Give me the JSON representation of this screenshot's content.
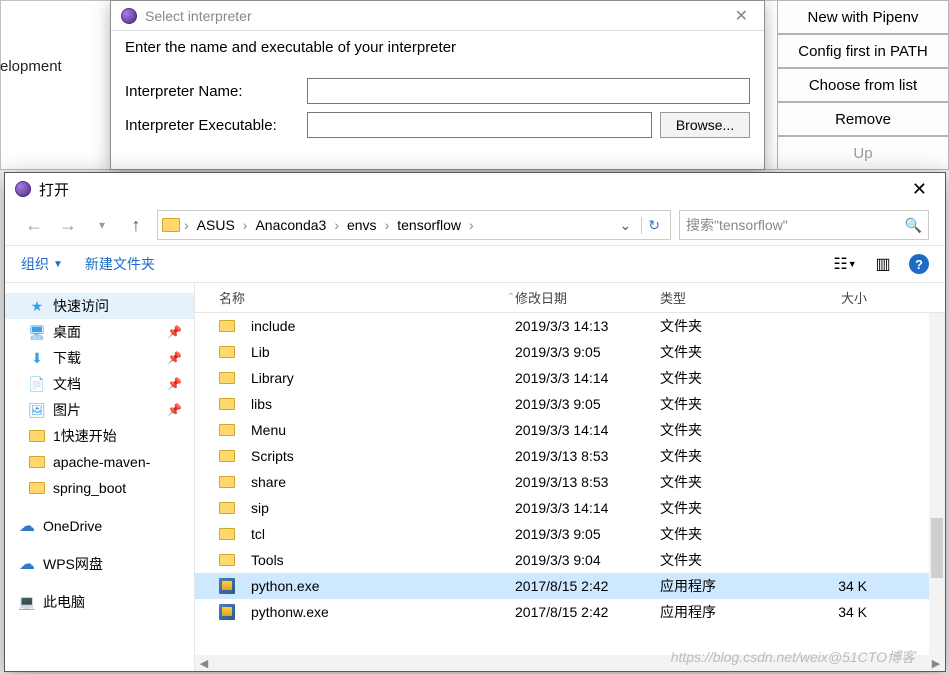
{
  "background": {
    "leftLabel": "elopment"
  },
  "rightButtons": {
    "b1": "New with Pipenv",
    "b2": "Config first in PATH",
    "b3": "Choose from list",
    "b4": "Remove",
    "b5": "Up"
  },
  "interpDialog": {
    "title": "Select interpreter",
    "prompt": "Enter the name and executable of your interpreter",
    "nameLabel": "Interpreter Name:",
    "execLabel": "Interpreter Executable:",
    "browse": "Browse..."
  },
  "fileDialog": {
    "title": "打开",
    "path": {
      "seg1": "ASUS",
      "seg2": "Anaconda3",
      "seg3": "envs",
      "seg4": "tensorflow"
    },
    "searchPlaceholder": "搜索\"tensorflow\"",
    "toolbar": {
      "organize": "组织",
      "newFolder": "新建文件夹"
    },
    "sidebar": {
      "quickAccess": "快速访问",
      "desktop": "桌面",
      "downloads": "下载",
      "documents": "文档",
      "pictures": "图片",
      "folder1": "1快速开始",
      "folder2": "apache-maven-",
      "folder3": "spring_boot",
      "onedrive": "OneDrive",
      "wps": "WPS网盘",
      "thispc": "此电脑"
    },
    "columns": {
      "name": "名称",
      "date": "修改日期",
      "type": "类型",
      "size": "大小"
    },
    "rows": [
      {
        "name": "include",
        "date": "2019/3/3 14:13",
        "type": "文件夹",
        "size": "",
        "kind": "folder"
      },
      {
        "name": "Lib",
        "date": "2019/3/3 9:05",
        "type": "文件夹",
        "size": "",
        "kind": "folder"
      },
      {
        "name": "Library",
        "date": "2019/3/3 14:14",
        "type": "文件夹",
        "size": "",
        "kind": "folder"
      },
      {
        "name": "libs",
        "date": "2019/3/3 9:05",
        "type": "文件夹",
        "size": "",
        "kind": "folder"
      },
      {
        "name": "Menu",
        "date": "2019/3/3 14:14",
        "type": "文件夹",
        "size": "",
        "kind": "folder"
      },
      {
        "name": "Scripts",
        "date": "2019/3/13 8:53",
        "type": "文件夹",
        "size": "",
        "kind": "folder"
      },
      {
        "name": "share",
        "date": "2019/3/13 8:53",
        "type": "文件夹",
        "size": "",
        "kind": "folder"
      },
      {
        "name": "sip",
        "date": "2019/3/3 14:14",
        "type": "文件夹",
        "size": "",
        "kind": "folder"
      },
      {
        "name": "tcl",
        "date": "2019/3/3 9:05",
        "type": "文件夹",
        "size": "",
        "kind": "folder"
      },
      {
        "name": "Tools",
        "date": "2019/3/3 9:04",
        "type": "文件夹",
        "size": "",
        "kind": "folder"
      },
      {
        "name": "python.exe",
        "date": "2017/8/15 2:42",
        "type": "应用程序",
        "size": "34 K",
        "kind": "exe",
        "selected": true
      },
      {
        "name": "pythonw.exe",
        "date": "2017/8/15 2:42",
        "type": "应用程序",
        "size": "34 K",
        "kind": "exe"
      }
    ],
    "watermark": "https://blog.csdn.net/weix@51CTO博客"
  }
}
